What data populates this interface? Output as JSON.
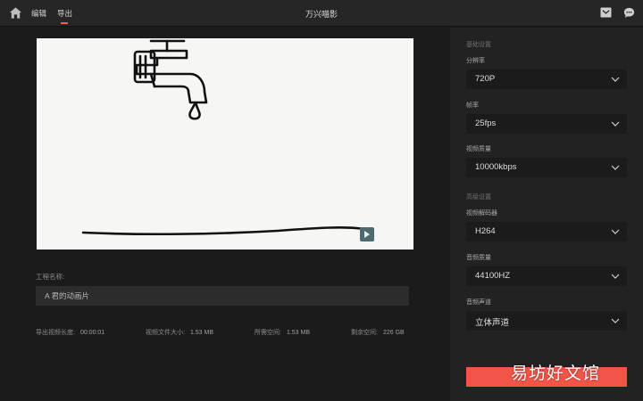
{
  "topbar": {
    "tabs": [
      {
        "label": "编辑"
      },
      {
        "label": "导出"
      }
    ],
    "title": "万兴喵影",
    "accent": "#ff5a4d"
  },
  "project": {
    "name_label": "工程名称:",
    "name_value": "A 君的动画片"
  },
  "stats": [
    {
      "label": "导出视频长度:",
      "value": "00:00:01"
    },
    {
      "label": "视频文件大小:",
      "value": "1.53 MB"
    },
    {
      "label": "所需空间:",
      "value": "1.53 MB"
    },
    {
      "label": "剩余空间:",
      "value": "226 GB"
    }
  ],
  "settings": {
    "basic_title": "基础设置",
    "advanced_title": "高级设置",
    "fields": [
      {
        "label": "分辨率",
        "value": "720P"
      },
      {
        "label": "帧率",
        "value": "25fps"
      },
      {
        "label": "视频质量",
        "value": "10000kbps"
      },
      {
        "label": "视频解码器",
        "value": "H264"
      },
      {
        "label": "音频质量",
        "value": "44100HZ"
      },
      {
        "label": "音频声道",
        "value": "立体声道"
      }
    ]
  },
  "export_button_color": "#f25548",
  "watermark": "易坊好文馆",
  "icons": [
    "home-icon",
    "inbox-icon",
    "chat-icon",
    "chevron-down-icon",
    "faucet-drawing",
    "app-badge-icon"
  ]
}
